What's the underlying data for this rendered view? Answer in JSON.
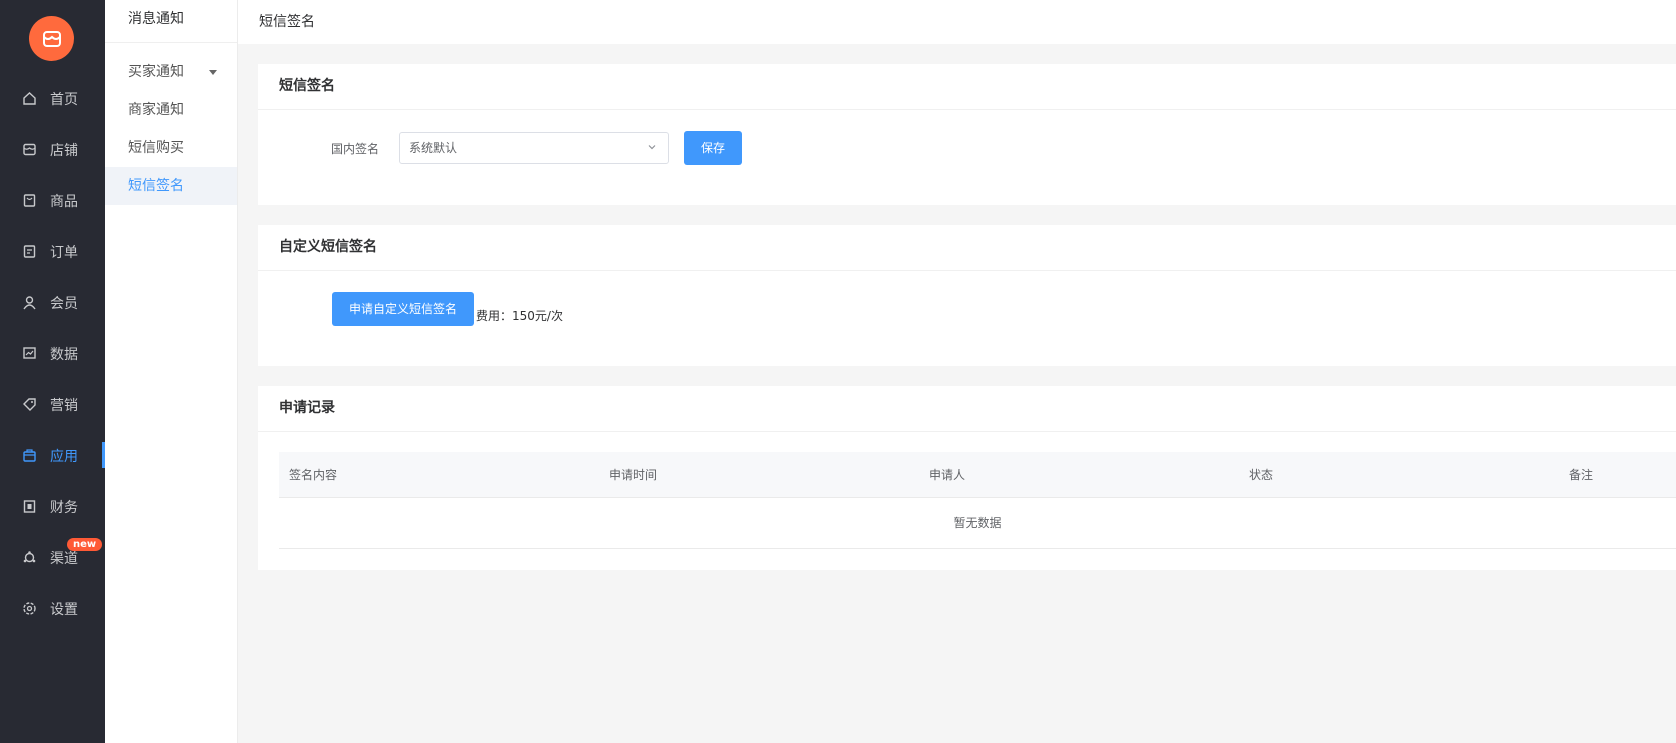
{
  "nav": {
    "items": [
      {
        "label": "首页",
        "icon": "home-icon"
      },
      {
        "label": "店铺",
        "icon": "store-icon"
      },
      {
        "label": "商品",
        "icon": "goods-icon"
      },
      {
        "label": "订单",
        "icon": "order-icon"
      },
      {
        "label": "会员",
        "icon": "member-icon"
      },
      {
        "label": "数据",
        "icon": "chart-icon"
      },
      {
        "label": "营销",
        "icon": "tag-icon"
      },
      {
        "label": "应用",
        "icon": "app-icon"
      },
      {
        "label": "财务",
        "icon": "finance-icon"
      },
      {
        "label": "渠道",
        "icon": "channel-icon"
      },
      {
        "label": "设置",
        "icon": "gear-icon"
      }
    ],
    "active": "应用",
    "channel_badge": "new"
  },
  "submenu": {
    "title": "消息通知",
    "items": [
      {
        "label": "买家通知"
      },
      {
        "label": "商家通知"
      },
      {
        "label": "短信购买"
      },
      {
        "label": "短信签名"
      }
    ],
    "active": "短信签名"
  },
  "header": {
    "breadcrumb": "短信签名"
  },
  "signature_card": {
    "title": "短信签名",
    "field_label": "国内签名",
    "select_value": "系统默认",
    "save_label": "保存"
  },
  "custom_card": {
    "title": "自定义短信签名",
    "apply_label": "申请自定义短信签名",
    "fee_text": "费用：150元/次"
  },
  "records_card": {
    "title": "申请记录",
    "columns": [
      "签名内容",
      "申请时间",
      "申请人",
      "状态",
      "备注"
    ],
    "empty_text": "暂无数据"
  },
  "colors": {
    "primary": "#4098fc",
    "nav_bg": "#282a33",
    "logo": "#ff6a3d",
    "badge": "#ff5a36"
  }
}
